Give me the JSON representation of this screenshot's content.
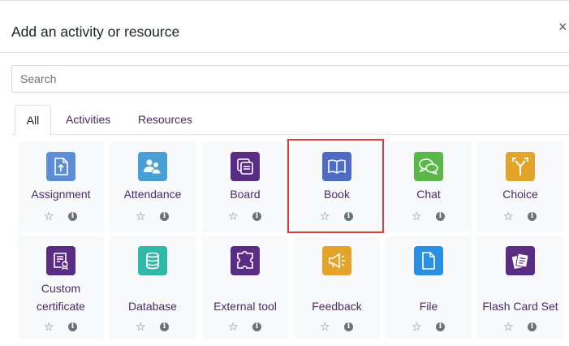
{
  "modal": {
    "title": "Add an activity or resource",
    "close_glyph": "×",
    "search_placeholder": "Search"
  },
  "tabs": [
    {
      "label": "All",
      "active": true
    },
    {
      "label": "Activities",
      "active": false
    },
    {
      "label": "Resources",
      "active": false
    }
  ],
  "tiles": [
    {
      "label": "Assignment",
      "icon": "assignment-icon",
      "color": "#5b8dd9"
    },
    {
      "label": "Attendance",
      "icon": "attendance-icon",
      "color": "#4a9ed6"
    },
    {
      "label": "Board",
      "icon": "board-icon",
      "color": "#5a2c84"
    },
    {
      "label": "Book",
      "icon": "book-icon",
      "color": "#4e6bc5"
    },
    {
      "label": "Chat",
      "icon": "chat-icon",
      "color": "#5ab849"
    },
    {
      "label": "Choice",
      "icon": "choice-icon",
      "color": "#e3a429"
    },
    {
      "label": "Custom\ncertificate",
      "icon": "certificate-icon",
      "color": "#5a2c84"
    },
    {
      "label": "Database",
      "icon": "database-icon",
      "color": "#2fb8a8"
    },
    {
      "label": "External tool",
      "icon": "puzzle-icon",
      "color": "#5a2c84"
    },
    {
      "label": "Feedback",
      "icon": "megaphone-icon",
      "color": "#e3a429"
    },
    {
      "label": "File",
      "icon": "file-icon",
      "color": "#2a8fe0"
    },
    {
      "label": "Flash Card Set",
      "icon": "flashcard-icon",
      "color": "#5a2c84"
    }
  ],
  "tile_actions": {
    "star_glyph": "☆",
    "info_glyph": "i"
  }
}
